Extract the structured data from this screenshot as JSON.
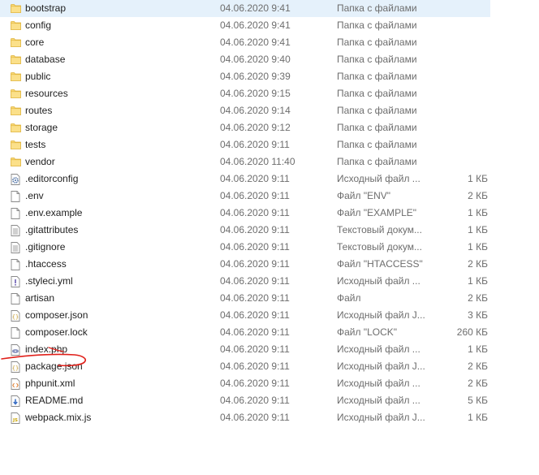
{
  "files": [
    {
      "icon": "folder-icon",
      "name": "bootstrap",
      "date": "04.06.2020 9:41",
      "type": "Папка с файлами",
      "size": ""
    },
    {
      "icon": "folder-icon",
      "name": "config",
      "date": "04.06.2020 9:41",
      "type": "Папка с файлами",
      "size": ""
    },
    {
      "icon": "folder-icon",
      "name": "core",
      "date": "04.06.2020 9:41",
      "type": "Папка с файлами",
      "size": ""
    },
    {
      "icon": "folder-icon",
      "name": "database",
      "date": "04.06.2020 9:40",
      "type": "Папка с файлами",
      "size": ""
    },
    {
      "icon": "folder-icon",
      "name": "public",
      "date": "04.06.2020 9:39",
      "type": "Папка с файлами",
      "size": ""
    },
    {
      "icon": "folder-icon",
      "name": "resources",
      "date": "04.06.2020 9:15",
      "type": "Папка с файлами",
      "size": ""
    },
    {
      "icon": "folder-icon",
      "name": "routes",
      "date": "04.06.2020 9:14",
      "type": "Папка с файлами",
      "size": ""
    },
    {
      "icon": "folder-icon",
      "name": "storage",
      "date": "04.06.2020 9:12",
      "type": "Папка с файлами",
      "size": ""
    },
    {
      "icon": "folder-icon",
      "name": "tests",
      "date": "04.06.2020 9:11",
      "type": "Папка с файлами",
      "size": ""
    },
    {
      "icon": "folder-icon",
      "name": "vendor",
      "date": "04.06.2020 11:40",
      "type": "Папка с файлами",
      "size": ""
    },
    {
      "icon": "gear-file-icon",
      "name": ".editorconfig",
      "date": "04.06.2020 9:11",
      "type": "Исходный файл ...",
      "size": "1 КБ"
    },
    {
      "icon": "blank-file-icon",
      "name": ".env",
      "date": "04.06.2020 9:11",
      "type": "Файл \"ENV\"",
      "size": "2 КБ"
    },
    {
      "icon": "blank-file-icon",
      "name": ".env.example",
      "date": "04.06.2020 9:11",
      "type": "Файл \"EXAMPLE\"",
      "size": "1 КБ"
    },
    {
      "icon": "text-file-icon",
      "name": ".gitattributes",
      "date": "04.06.2020 9:11",
      "type": "Текстовый докум...",
      "size": "1 КБ"
    },
    {
      "icon": "text-file-icon",
      "name": ".gitignore",
      "date": "04.06.2020 9:11",
      "type": "Текстовый докум...",
      "size": "1 КБ"
    },
    {
      "icon": "blank-file-icon",
      "name": ".htaccess",
      "date": "04.06.2020 9:11",
      "type": "Файл \"HTACCESS\"",
      "size": "2 КБ"
    },
    {
      "icon": "warning-file-icon",
      "name": ".styleci.yml",
      "date": "04.06.2020 9:11",
      "type": "Исходный файл ...",
      "size": "1 КБ"
    },
    {
      "icon": "blank-file-icon",
      "name": "artisan",
      "date": "04.06.2020 9:11",
      "type": "Файл",
      "size": "2 КБ"
    },
    {
      "icon": "json-file-icon",
      "name": "composer.json",
      "date": "04.06.2020 9:11",
      "type": "Исходный файл J...",
      "size": "3 КБ"
    },
    {
      "icon": "blank-file-icon",
      "name": "composer.lock",
      "date": "04.06.2020 9:11",
      "type": "Файл \"LOCK\"",
      "size": "260 КБ"
    },
    {
      "icon": "php-file-icon",
      "name": "index.php",
      "date": "04.06.2020 9:11",
      "type": "Исходный файл ...",
      "size": "1 КБ"
    },
    {
      "icon": "json-file-icon",
      "name": "package.json",
      "date": "04.06.2020 9:11",
      "type": "Исходный файл J...",
      "size": "2 КБ"
    },
    {
      "icon": "xml-file-icon",
      "name": "phpunit.xml",
      "date": "04.06.2020 9:11",
      "type": "Исходный файл ...",
      "size": "2 КБ"
    },
    {
      "icon": "markdown-file-icon",
      "name": "README.md",
      "date": "04.06.2020 9:11",
      "type": "Исходный файл ...",
      "size": "5 КБ"
    },
    {
      "icon": "js-file-icon",
      "name": "webpack.mix.js",
      "date": "04.06.2020 9:11",
      "type": "Исходный файл J...",
      "size": "1 КБ"
    }
  ],
  "selected_index": 0,
  "colors": {
    "selection": "#e5f1fb",
    "folder": "#f8d775",
    "folder_dark": "#e0b43c",
    "annotation": "#e0201a"
  }
}
